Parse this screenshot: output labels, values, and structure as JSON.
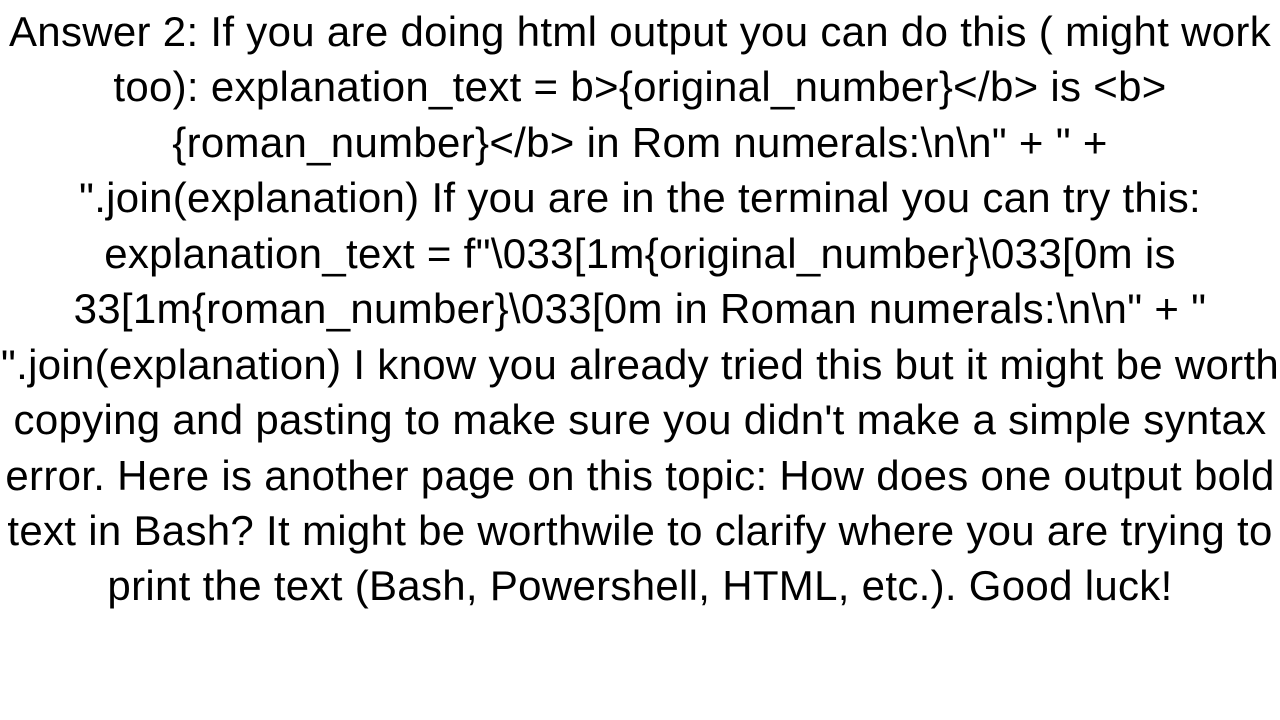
{
  "answer": {
    "text": "Answer 2: If you are doing html output you can do this ( might work too): explanation_text = b>{original_number}</b> is <b>{roman_number}</b> in Rom numerals:\\n\\n\" + \" + \".join(explanation)  If you are in the terminal you can try this: explanation_text = f\"\\033[1m{original_number}\\033[0m is 33[1m{roman_number}\\033[0m in Roman numerals:\\n\\n\" + \" \".join(explanation)  I know you already tried this but it might be worth copying and pasting to make sure you didn't make a simple syntax error. Here is another page on this topic: How does one output bold text in Bash? It might be worthwile to clarify where you are trying to print the text (Bash, Powershell, HTML, etc.). Good luck!"
  }
}
